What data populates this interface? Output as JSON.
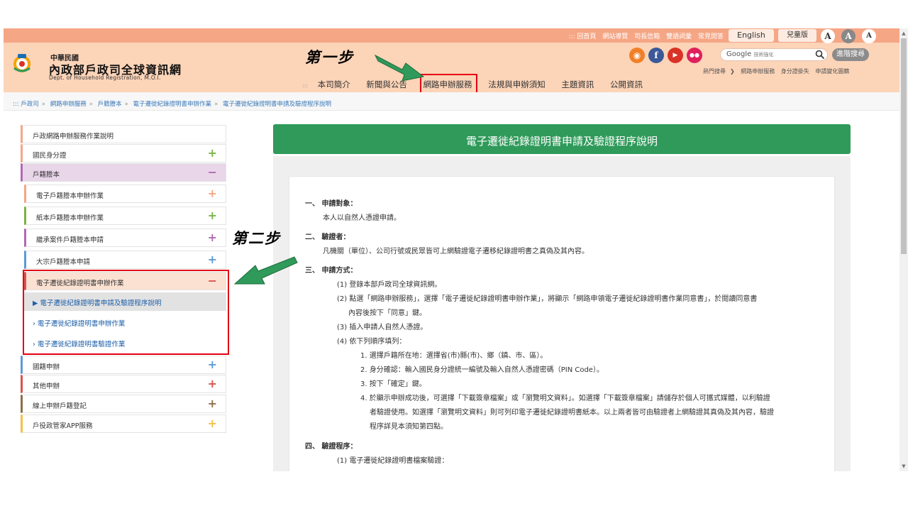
{
  "topbar": {
    "links": [
      "::: 回首頁",
      "網站導覽",
      "司長信箱",
      "雙語詞彙",
      "常見問答"
    ],
    "english": "English",
    "kids": "兒童版",
    "font_sizes": [
      "A",
      "A",
      "A"
    ]
  },
  "logo": {
    "small": "中華民國",
    "big": "內政部戶政司全球資訊網",
    "en": "Dept. of Household Registration, M.O.I."
  },
  "search": {
    "placeholder": "Google",
    "placeholder_sub": "技術強化",
    "advanced": "進階搜尋",
    "hot_label": "熱門搜尋",
    "hot_items": [
      "網路申辦服務",
      "身分證掛失",
      "申請變化圖籍"
    ]
  },
  "nav": {
    "dots": ":::",
    "items": [
      "本司簡介",
      "新聞與公告",
      "網路申辦服務",
      "法規與申辦須知",
      "主題資訊",
      "公開資訊"
    ]
  },
  "breadcrumb": [
    "::: 戶政司",
    "網路申辦服務",
    "戶籍謄本",
    "電子遷徙紀錄證明書申辦作業",
    "電子遷徙紀錄證明書申請及驗證程序說明"
  ],
  "sidebar": {
    "items": [
      {
        "label": "戶政網路申辦服務作業說明",
        "icon": ""
      },
      {
        "label": "國民身分證",
        "icon": "+"
      },
      {
        "label": "戶籍謄本",
        "icon": "−"
      },
      {
        "label": "電子戶籍謄本申辦作業",
        "icon": "+"
      },
      {
        "label": "紙本戶籍謄本申辦作業",
        "icon": "+"
      },
      {
        "label": "繼承案件戶籍謄本申請",
        "icon": "+"
      },
      {
        "label": "大宗戶籍謄本申請",
        "icon": "+"
      },
      {
        "label": "電子遷徙紀錄證明書申辦作業",
        "icon": "−"
      },
      {
        "label": "▶ 電子遷徙紀錄證明書申請及驗證程序說明",
        "icon": ""
      },
      {
        "label": "› 電子遷徙紀錄證明書申辦作業",
        "icon": ""
      },
      {
        "label": "› 電子遷徙紀錄證明書驗證作業",
        "icon": ""
      },
      {
        "label": "國籍申辦",
        "icon": "+"
      },
      {
        "label": "其他申辦",
        "icon": "+"
      },
      {
        "label": "線上申辦戶籍登記",
        "icon": "+"
      },
      {
        "label": "戶役政管家APP服務",
        "icon": "+"
      }
    ]
  },
  "annotations": {
    "step1": "第一步",
    "step2": "第二步"
  },
  "content": {
    "title": "電子遷徙紀錄證明書申請及驗證程序說明",
    "s1_head": "一、 申請對象：",
    "s1_body": "本人以自然人憑證申請。",
    "s2_head": "二、 驗證者：",
    "s2_body": "凡機關（單位）、公司行號或民眾皆可上網驗證電子遷移紀錄證明書之真偽及其內容。",
    "s3_head": "三、 申請方式：",
    "s3_1": "(1) 登錄本部戶政司全球資訊網。",
    "s3_2a": "(2) 點選「網路申辦服務」，選擇「電子遷徙紀錄證明書申辦作業」，將顯示「網路申領電子遷徙紀錄證明書作業同意書」，於閱讀同意書",
    "s3_2b": "內容後按下「同意」鍵。",
    "s3_3": "(3) 插入申請人自然人憑證。",
    "s3_4": "(4) 依下列順序填列：",
    "s3_4_1": "1. 選擇戶籍所在地：選擇省(市)縣(市)、鄉（鎮、市、區）。",
    "s3_4_2": "2. 身分確認：輸入國民身分證統一編號及輸入自然人憑證密碼（PIN Code）。",
    "s3_4_3": "3. 按下「確定」鍵。",
    "s3_4_4a": "4. 於顯示申辦成功後，可選擇「下載簽章檔案」或「瀏覽明文資料」。如選擇「下載簽章檔案」請儲存於個人可攜式媒體，以利驗證",
    "s3_4_4b": "者驗證使用。如選擇「瀏覽明文資料」則可列印電子遷徙紀錄證明書紙本。以上兩者皆可由驗證者上網驗證其真偽及其內容，驗證",
    "s3_4_4c": "程序詳見本須知第四點。",
    "s4_head": "四、 驗證程序：",
    "s4_1": "(1) 電子遷徙紀錄證明書檔案驗證："
  }
}
